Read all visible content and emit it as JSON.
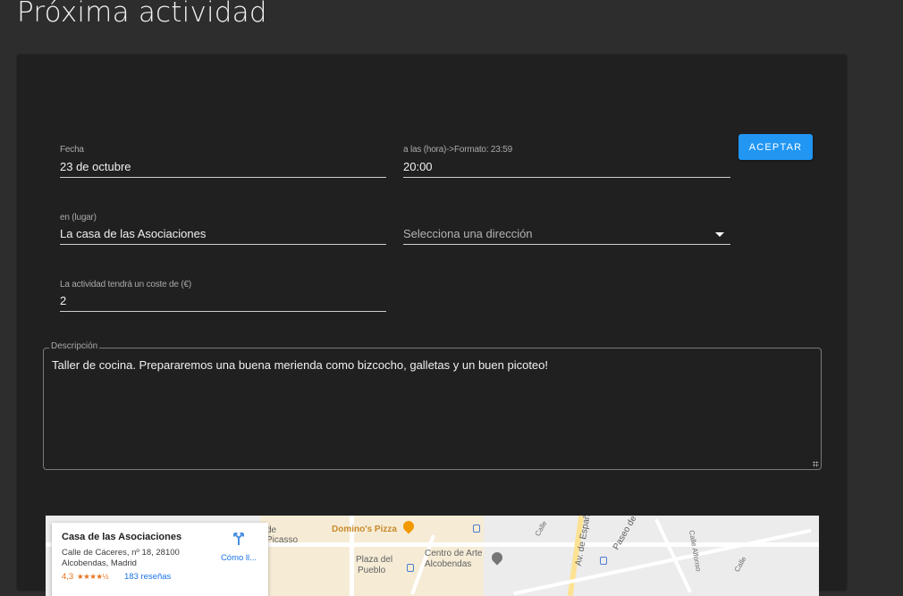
{
  "page": {
    "title": "Próxima actividad"
  },
  "form": {
    "fecha": {
      "label": "Fecha",
      "value": "23 de octubre"
    },
    "hora": {
      "label": "a las (hora)->Formato: 23:59",
      "value": "20:00"
    },
    "lugar": {
      "label": "en (lugar)",
      "value": "La casa de las Asociaciones"
    },
    "direccion": {
      "placeholder": "Selecciona una dirección"
    },
    "coste": {
      "label": "La actividad tendrá un coste de (€)",
      "value": "2"
    },
    "descripcion": {
      "label": "Descripción",
      "value": "Taller de cocina. Prepararemos una buena merienda como bizcocho, galletas y un buen picoteo!"
    },
    "accept_label": "Aceptar"
  },
  "map": {
    "place_name": "Casa de las Asociaciones",
    "address_line1": "Calle de Cáceres, nº 18, 28100",
    "address_line2": "Alcobendas, Madrid",
    "rating": "4,3",
    "stars": "★★★★½",
    "reviews": "183 reseñas",
    "directions_label": "Cómo ll...",
    "labels": {
      "dominos": "Domino's Pizza",
      "plaza1": "Plaza del",
      "plaza2": "Pueblo",
      "centro1": "Centro de Arte",
      "centro2": "Alcobendas",
      "picasso": "Picasso",
      "de": "de",
      "paseo": "Paseo de",
      "av_espana": "Av. de Españ",
      "calle": "Calle",
      "calle_alfonso": "Calle Alfonso",
      "calle2": "Calle"
    },
    "colors": {
      "pizza_pin": "#f29900",
      "centro_pin": "#757575",
      "link": "#1a73e8",
      "rating": "#e7711b"
    }
  },
  "colors": {
    "background": "#2d2d2d",
    "card": "#202020",
    "accent": "#2196f3"
  }
}
